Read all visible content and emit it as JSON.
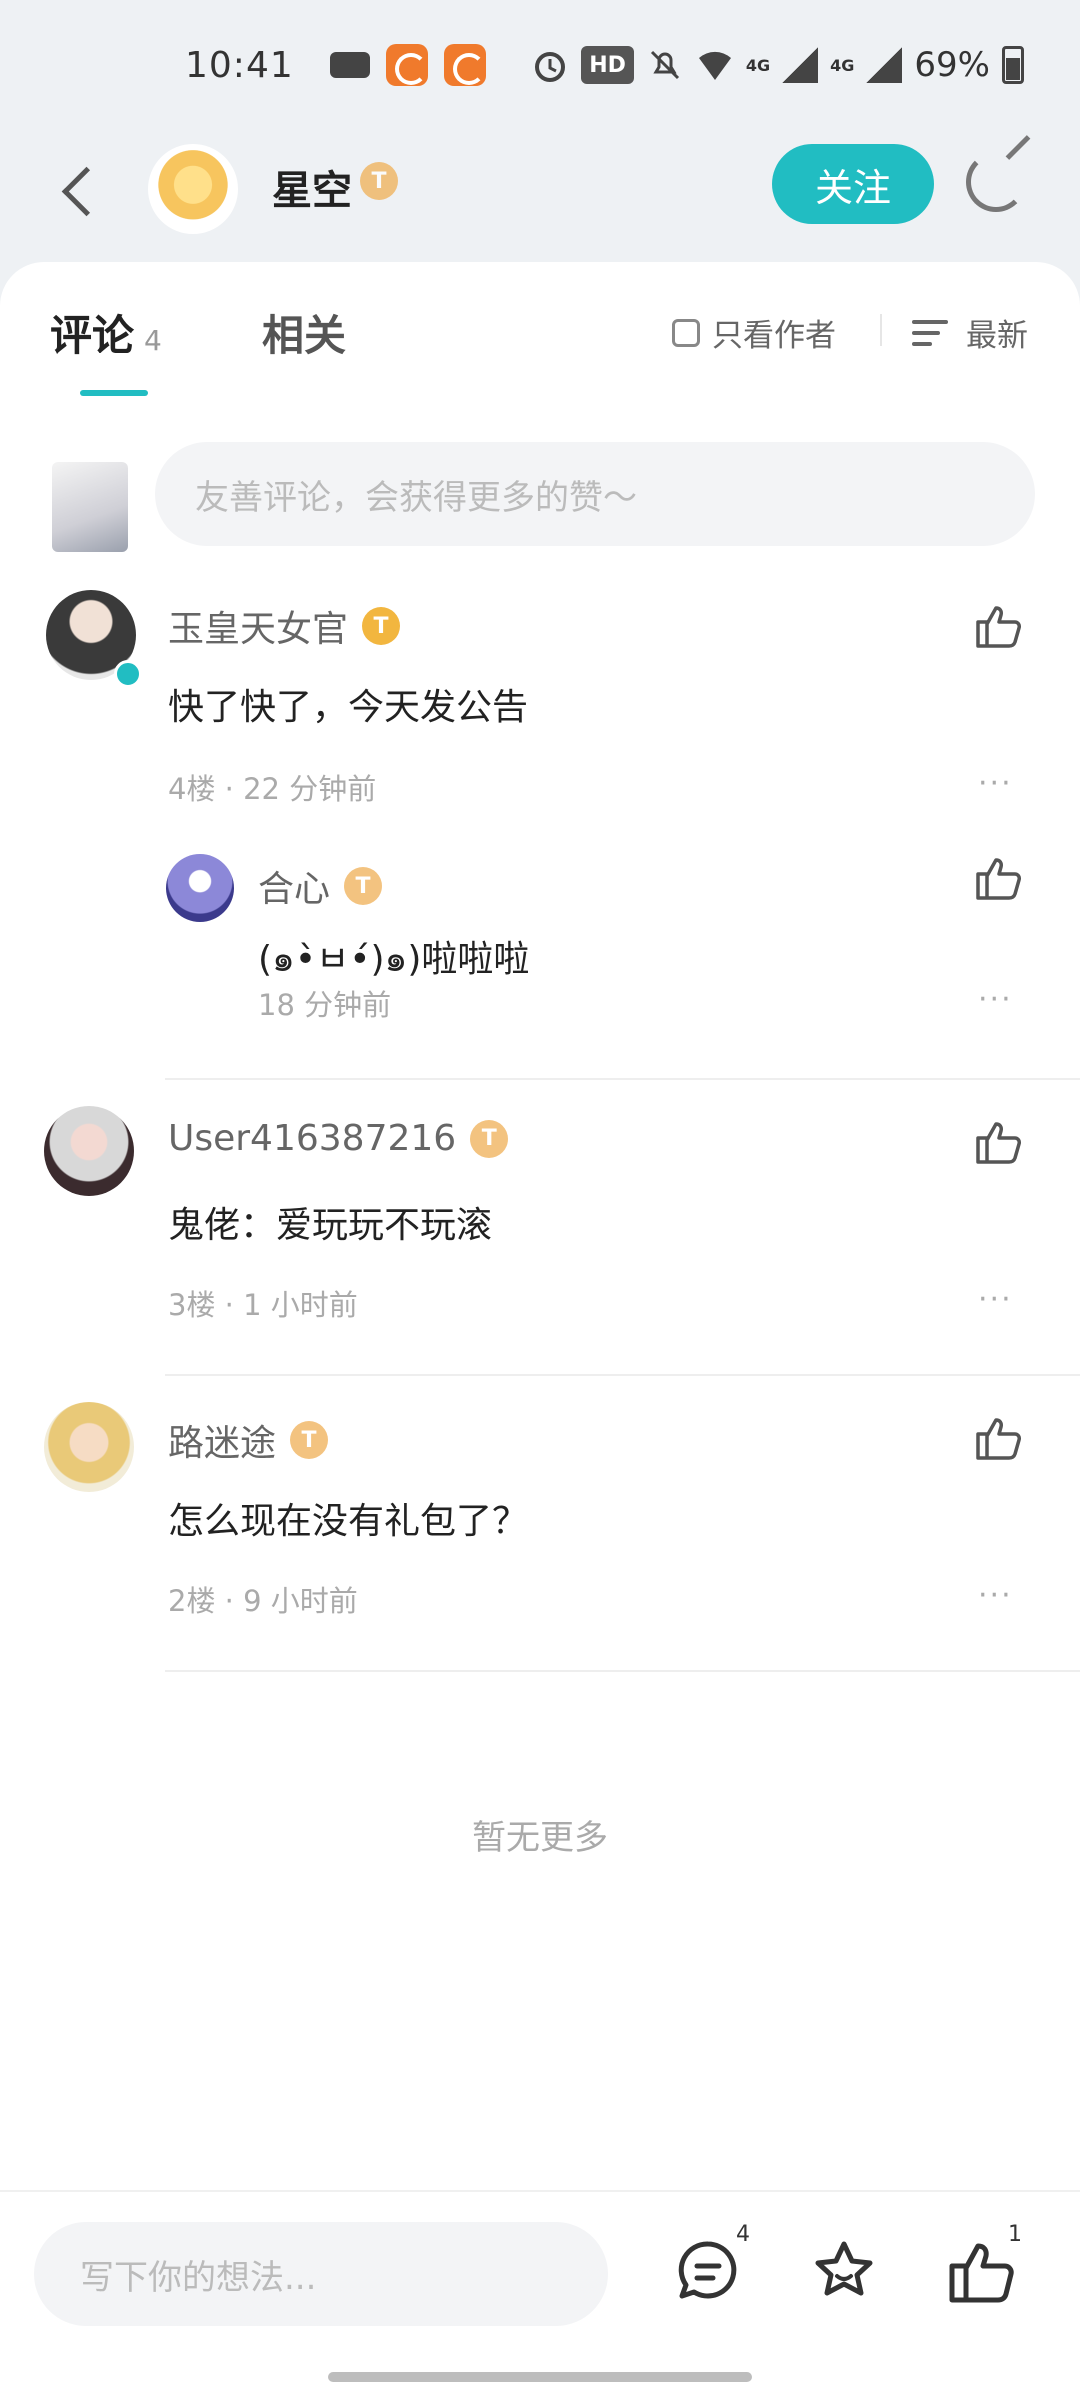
{
  "status_bar": {
    "time": "10:41",
    "network_hd": "HD",
    "signal_1": "4G",
    "signal_2": "4G",
    "battery": "69%",
    "icons": [
      "gamepad-icon",
      "app-orange-icon",
      "app-orange-icon",
      "alarm-icon",
      "hd-icon",
      "mute-icon",
      "wifi-icon",
      "signal-icon",
      "signal-icon",
      "battery-icon"
    ]
  },
  "header": {
    "username": "星空",
    "level": "T",
    "follow_label": "关注",
    "icons": [
      "back-icon",
      "share-icon"
    ]
  },
  "tabs": {
    "comments_label": "评论",
    "comments_count": "4",
    "related_label": "相关",
    "author_only_label": "只看作者",
    "sort_label": "最新"
  },
  "comment_input": {
    "placeholder": "友善评论，会获得更多的赞～"
  },
  "comments": [
    {
      "username": "玉皇天女官",
      "level": "T",
      "text": "快了快了，今天发公告",
      "meta": "4楼 · 22 分钟前",
      "reply": {
        "username": "合心",
        "level": "T",
        "text": "(๑•̀ㅂ•́)๑)啦啦啦",
        "meta": "18 分钟前"
      }
    },
    {
      "username": "User416387216",
      "level": "T",
      "text": "鬼佬：爱玩玩不玩滚",
      "meta": "3楼 · 1 小时前"
    },
    {
      "username": "路迷途",
      "level": "T",
      "text": "怎么现在没有礼包了？",
      "meta": "2楼 · 9 小时前"
    }
  ],
  "no_more_label": "暂无更多",
  "more_label": "···",
  "bottom_bar": {
    "input_placeholder": "写下你的想法...",
    "comment_count": "4",
    "like_count": "1"
  },
  "colors": {
    "accent": "#21bdc2",
    "badge": "#f0b056",
    "background": "#eef1f4"
  }
}
